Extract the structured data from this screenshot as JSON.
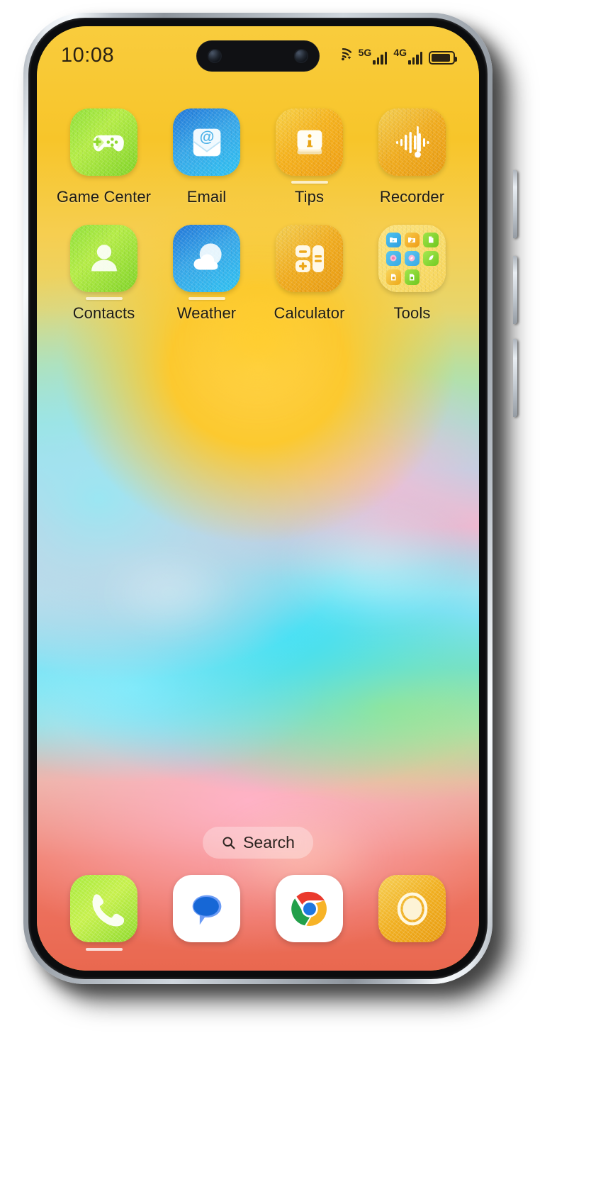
{
  "device": {
    "frame_color": "#cfd6dd",
    "bezel_color": "#0b0c0e",
    "buttons": [
      {
        "name": "volume-up"
      },
      {
        "name": "volume-down"
      },
      {
        "name": "power"
      }
    ]
  },
  "status_bar": {
    "time": "10:08",
    "icons": [
      {
        "name": "wifi-icon",
        "label": ""
      },
      {
        "name": "signal-5g-icon",
        "label": "5G"
      },
      {
        "name": "signal-4g-icon",
        "label": "4G"
      },
      {
        "name": "battery-icon",
        "label": ""
      }
    ],
    "battery_level_percent": 88,
    "text_color": "#2a2214"
  },
  "dynamic_island": {
    "camera_count": 2
  },
  "home_screen": {
    "rows": [
      [
        {
          "label": "Game Center",
          "icon": "gamepad-icon",
          "bg": "#8fe03a",
          "underbar": false
        },
        {
          "label": "Email",
          "icon": "envelope-at-icon",
          "bg": "#2fa6e8",
          "underbar": false
        },
        {
          "label": "Tips",
          "icon": "info-card-icon",
          "bg": "#f5b21c",
          "underbar": true
        },
        {
          "label": "Recorder",
          "icon": "waveform-icon",
          "bg": "#ef9d12",
          "underbar": false
        }
      ],
      [
        {
          "label": "Contacts",
          "icon": "person-icon",
          "bg": "#8fe03a",
          "underbar": true
        },
        {
          "label": "Weather",
          "icon": "sun-cloud-icon",
          "bg": "#2fa6e8",
          "underbar": true
        },
        {
          "label": "Calculator",
          "icon": "calculator-icon",
          "bg": "#f0ab1d",
          "underbar": false
        },
        {
          "label": "Tools",
          "icon": "folder-icon",
          "bg": "#f9dc6a",
          "underbar": false
        }
      ]
    ],
    "folder_tools": {
      "name": "Tools",
      "mini_icons": [
        "video-folder-icon",
        "music-folder-icon",
        "document-icon",
        "disc-icon",
        "compass-icon",
        "leaf-icon",
        "sim-card-icon",
        "sim-card-green-icon",
        ""
      ]
    }
  },
  "search": {
    "label": "Search",
    "icon": "search-icon"
  },
  "dock": {
    "apps": [
      {
        "name": "Phone",
        "icon": "phone-handset-icon",
        "bg": "#a6ea3c",
        "underbar": true
      },
      {
        "name": "Messages",
        "icon": "message-bubble-icon",
        "bg": "#ffffff",
        "underbar": false
      },
      {
        "name": "Chrome",
        "icon": "chrome-icon",
        "bg": "#ffffff",
        "underbar": false
      },
      {
        "name": "Camera",
        "icon": "camera-ring-icon",
        "bg": "#f0ae1e",
        "underbar": false
      }
    ]
  },
  "wallpaper": {
    "description": "blurred pastel gradient mesh",
    "top_color": "#f9cc3d",
    "mid_color": "#5fdcf0",
    "bottom_color": "#e9684f"
  }
}
